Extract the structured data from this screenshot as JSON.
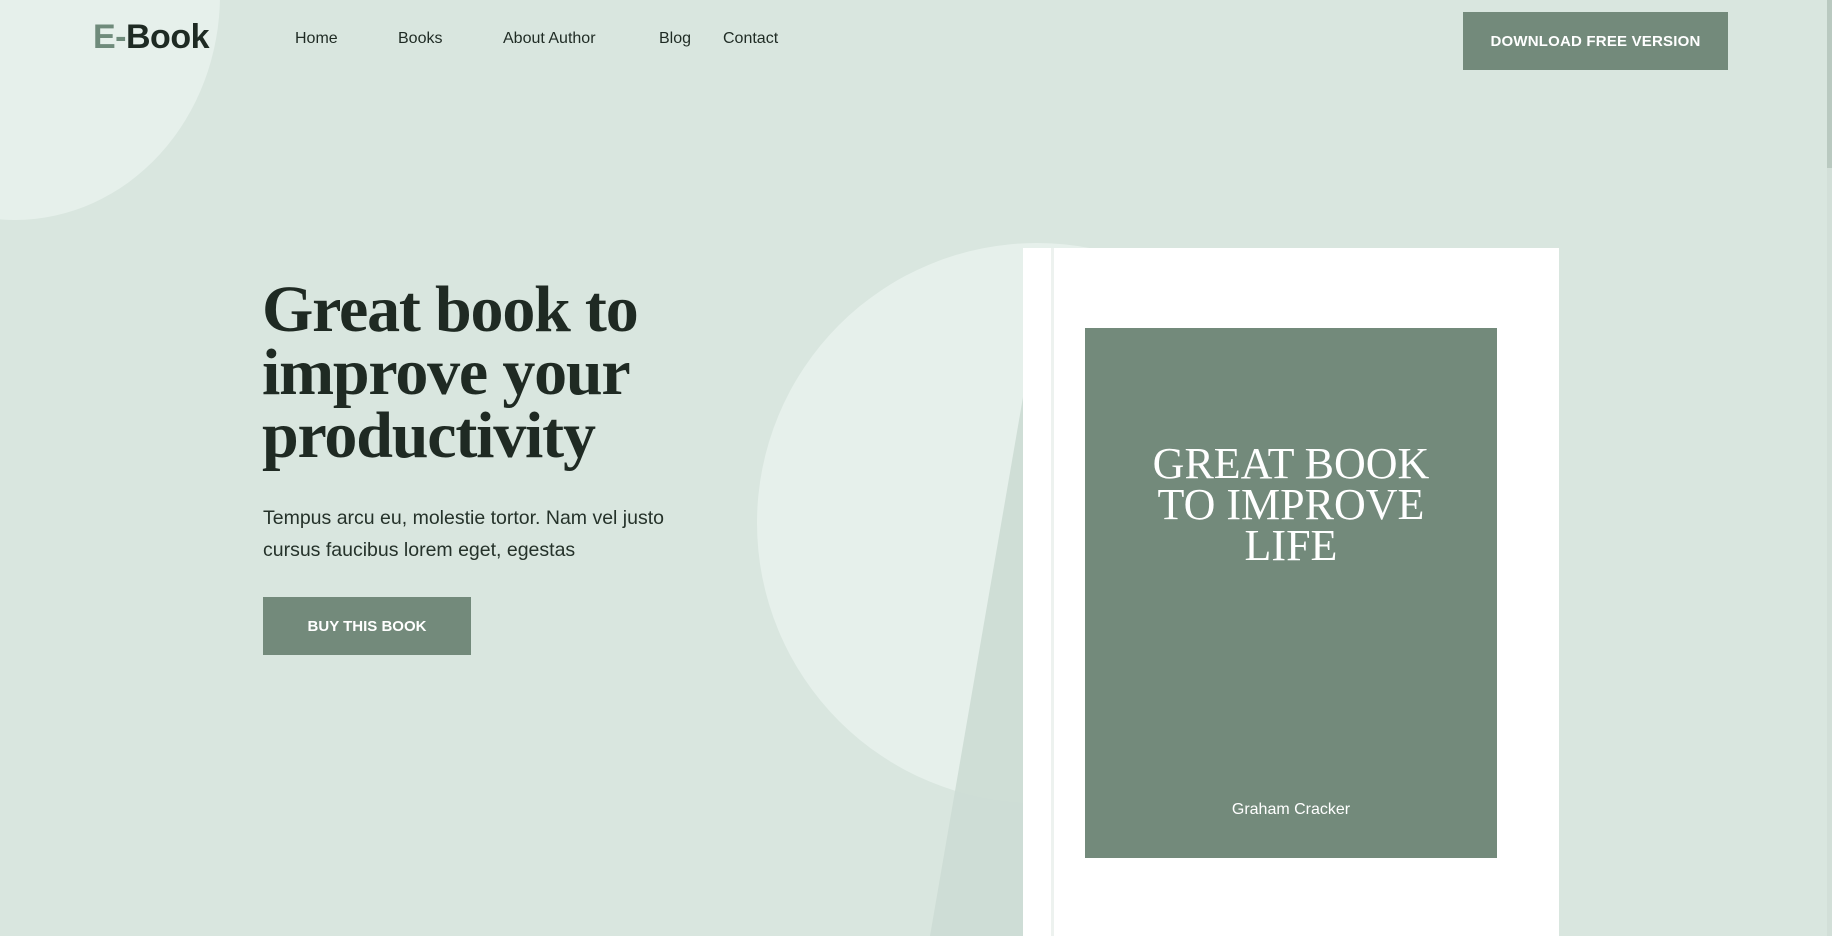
{
  "header": {
    "logo_accent": "E-",
    "logo_text": "Book",
    "nav": [
      {
        "label": "Home"
      },
      {
        "label": "Books"
      },
      {
        "label": "About Author"
      },
      {
        "label": "Blog"
      },
      {
        "label": "Contact"
      }
    ],
    "download_label": "DOWNLOAD FREE VERSION"
  },
  "hero": {
    "title_lines": [
      "Great book to",
      "improve your",
      "productivity"
    ],
    "description_lines": [
      "Tempus arcu eu, molestie tortor. Nam vel justo",
      "cursus faucibus lorem eget, egestas"
    ],
    "buy_label": "BUY THIS BOOK"
  },
  "book": {
    "cover_title_lines": [
      "GREAT BOOK",
      "TO IMPROVE",
      "LIFE"
    ],
    "author": "Graham Cracker"
  },
  "colors": {
    "background": "#d9e6df",
    "accent": "#738a7b",
    "text": "#1f2a23",
    "white": "#ffffff"
  }
}
